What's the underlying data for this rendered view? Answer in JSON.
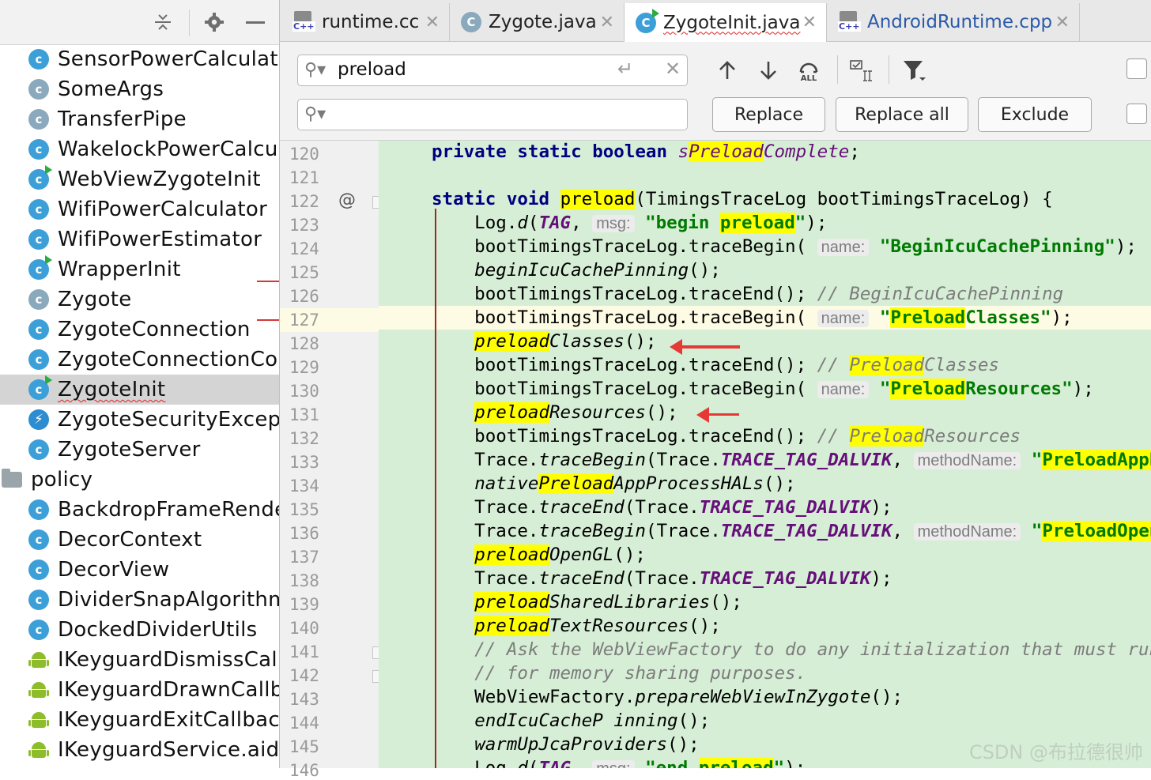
{
  "left_toolbar": {
    "icons": [
      "collapse-all-icon",
      "gear-icon",
      "minimize-icon"
    ]
  },
  "tree": [
    {
      "label": "SensorPowerCalculator",
      "icon": "class-icon"
    },
    {
      "label": "SomeArgs",
      "icon": "class-icon-greyed"
    },
    {
      "label": "TransferPipe",
      "icon": "class-icon-greyed"
    },
    {
      "label": "WakelockPowerCalculator",
      "icon": "class-icon"
    },
    {
      "label": "WebViewZygoteInit",
      "icon": "runnable-class-icon"
    },
    {
      "label": "WifiPowerCalculator",
      "icon": "class-icon"
    },
    {
      "label": "WifiPowerEstimator",
      "icon": "class-icon"
    },
    {
      "label": "WrapperInit",
      "icon": "runnable-class-icon"
    },
    {
      "label": "Zygote",
      "icon": "class-icon-greyed"
    },
    {
      "label": "ZygoteConnection",
      "icon": "class-icon"
    },
    {
      "label": "ZygoteConnectionConstants",
      "icon": "class-icon"
    },
    {
      "label": "ZygoteInit",
      "icon": "runnable-class-icon",
      "selected": true
    },
    {
      "label": "ZygoteSecurityException",
      "icon": "exception-class-icon"
    },
    {
      "label": "ZygoteServer",
      "icon": "class-icon"
    },
    {
      "label": "policy",
      "icon": "folder-icon"
    },
    {
      "label": "BackdropFrameRenderer",
      "icon": "class-icon"
    },
    {
      "label": "DecorContext",
      "icon": "class-icon"
    },
    {
      "label": "DecorView",
      "icon": "class-icon"
    },
    {
      "label": "DividerSnapAlgorithm",
      "icon": "class-icon"
    },
    {
      "label": "DockedDividerUtils",
      "icon": "class-icon"
    },
    {
      "label": "IKeyguardDismissCallback",
      "icon": "android-icon"
    },
    {
      "label": "IKeyguardDrawnCallback",
      "icon": "android-icon"
    },
    {
      "label": "IKeyguardExitCallback",
      "icon": "android-icon"
    },
    {
      "label": "IKeyguardService.aidl",
      "icon": "android-icon"
    }
  ],
  "tabs": [
    {
      "label": "runtime.cc",
      "icon": "cpp-file-icon"
    },
    {
      "label": "Zygote.java",
      "icon": "class-icon-greyed"
    },
    {
      "label": "ZygoteInit.java",
      "icon": "runnable-class-icon",
      "active": true
    },
    {
      "label": "AndroidRuntime.cpp",
      "icon": "cpp-file-icon"
    }
  ],
  "find": {
    "search_value": "preload",
    "replace_value": "",
    "replace_label": "Replace",
    "replace_all_label": "Replace all",
    "exclude_label": "Exclude",
    "all_label": "ALL"
  },
  "editor": {
    "current_line": 127,
    "line_numbers": [
      "120",
      "121",
      "122",
      "123",
      "124",
      "125",
      "126",
      "127",
      "128",
      "129",
      "130",
      "131",
      "132",
      "133",
      "134",
      "135",
      "136",
      "137",
      "138",
      "139",
      "140",
      "141",
      "142",
      "143",
      "144",
      "145",
      "146"
    ],
    "gutter_marker_line": 122,
    "gutter_marker": "@",
    "hints": {
      "msg": "msg:",
      "name": "name:",
      "methodName": "methodName:"
    },
    "lines": [
      [
        [
          "kw",
          "private static boolean "
        ],
        [
          "fld",
          "s"
        ],
        [
          "fld hl",
          "Preload"
        ],
        [
          "fld",
          "Complete"
        ],
        [
          "t",
          ";"
        ]
      ],
      [],
      [
        [
          "kw",
          "static void "
        ],
        [
          "hl",
          "preload"
        ],
        [
          "t",
          "(TimingsTraceLog bootTimingsTraceLog) {"
        ]
      ],
      [
        [
          "t",
          "    Log."
        ],
        [
          "it",
          "d"
        ],
        [
          "t",
          "("
        ],
        [
          "cst",
          "TAG"
        ],
        [
          "t",
          ", "
        ],
        [
          "hint",
          "msg:"
        ],
        [
          "t",
          " "
        ],
        [
          "str",
          "\"begin "
        ],
        [
          "str hl",
          "preload"
        ],
        [
          "str",
          "\""
        ],
        [
          "t",
          ");"
        ]
      ],
      [
        [
          "t",
          "    bootTimingsTraceLog.traceBegin( "
        ],
        [
          "hint",
          "name:"
        ],
        [
          "t",
          " "
        ],
        [
          "str",
          "\"BeginIcuCachePinning\""
        ],
        [
          "t",
          ");"
        ]
      ],
      [
        [
          "t",
          "    "
        ],
        [
          "it",
          "beginIcuCachePinning"
        ],
        [
          "t",
          "();"
        ]
      ],
      [
        [
          "t",
          "    bootTimingsTraceLog.traceEnd(); "
        ],
        [
          "cmt",
          "// BeginIcuCachePinning"
        ]
      ],
      [
        [
          "t",
          "    bootTimingsTraceLog.traceBegin( "
        ],
        [
          "hint",
          "name:"
        ],
        [
          "t",
          " "
        ],
        [
          "str",
          "\""
        ],
        [
          "str hl",
          "Preload"
        ],
        [
          "str",
          "Classes\""
        ],
        [
          "t",
          ");"
        ]
      ],
      [
        [
          "t",
          "    "
        ],
        [
          "it hl",
          "preload"
        ],
        [
          "it",
          "Classes"
        ],
        [
          "t",
          "();"
        ]
      ],
      [
        [
          "t",
          "    bootTimingsTraceLog.traceEnd(); "
        ],
        [
          "cmt",
          "// "
        ],
        [
          "cmt hl",
          "Preload"
        ],
        [
          "cmt",
          "Classes"
        ]
      ],
      [
        [
          "t",
          "    bootTimingsTraceLog.traceBegin( "
        ],
        [
          "hint",
          "name:"
        ],
        [
          "t",
          " "
        ],
        [
          "str",
          "\""
        ],
        [
          "str hl",
          "Preload"
        ],
        [
          "str",
          "Resources\""
        ],
        [
          "t",
          ");"
        ]
      ],
      [
        [
          "t",
          "    "
        ],
        [
          "it hl",
          "preload"
        ],
        [
          "it",
          "Resources"
        ],
        [
          "t",
          "();"
        ]
      ],
      [
        [
          "t",
          "    bootTimingsTraceLog.traceEnd(); "
        ],
        [
          "cmt",
          "// "
        ],
        [
          "cmt hl",
          "Preload"
        ],
        [
          "cmt",
          "Resources"
        ]
      ],
      [
        [
          "t",
          "    Trace."
        ],
        [
          "it",
          "traceBegin"
        ],
        [
          "t",
          "(Trace."
        ],
        [
          "cst",
          "TRACE_TAG_DALVIK"
        ],
        [
          "t",
          ", "
        ],
        [
          "hint",
          "methodName:"
        ],
        [
          "t",
          " "
        ],
        [
          "str",
          "\""
        ],
        [
          "str hl",
          "PreloadAppProcessHALs"
        ],
        [
          "str",
          "\""
        ]
      ],
      [
        [
          "t",
          "    "
        ],
        [
          "it",
          "native"
        ],
        [
          "it hl",
          "Preload"
        ],
        [
          "it",
          "AppProcessHALs"
        ],
        [
          "t",
          "();"
        ]
      ],
      [
        [
          "t",
          "    Trace."
        ],
        [
          "it",
          "traceEnd"
        ],
        [
          "t",
          "(Trace."
        ],
        [
          "cst",
          "TRACE_TAG_DALVIK"
        ],
        [
          "t",
          ");"
        ]
      ],
      [
        [
          "t",
          "    Trace."
        ],
        [
          "it",
          "traceBegin"
        ],
        [
          "t",
          "(Trace."
        ],
        [
          "cst",
          "TRACE_TAG_DALVIK"
        ],
        [
          "t",
          ", "
        ],
        [
          "hint",
          "methodName:"
        ],
        [
          "t",
          " "
        ],
        [
          "str",
          "\""
        ],
        [
          "str hl",
          "PreloadOpenGL"
        ],
        [
          "str",
          "\""
        ]
      ],
      [
        [
          "t",
          "    "
        ],
        [
          "it hl",
          "preload"
        ],
        [
          "it",
          "OpenGL"
        ],
        [
          "t",
          "();"
        ]
      ],
      [
        [
          "t",
          "    Trace."
        ],
        [
          "it",
          "traceEnd"
        ],
        [
          "t",
          "(Trace."
        ],
        [
          "cst",
          "TRACE_TAG_DALVIK"
        ],
        [
          "t",
          ");"
        ]
      ],
      [
        [
          "t",
          "    "
        ],
        [
          "it hl",
          "preload"
        ],
        [
          "it",
          "SharedLibraries"
        ],
        [
          "t",
          "();"
        ]
      ],
      [
        [
          "t",
          "    "
        ],
        [
          "it hl",
          "preload"
        ],
        [
          "it",
          "TextResources"
        ],
        [
          "t",
          "();"
        ]
      ],
      [
        [
          "t",
          "    "
        ],
        [
          "cmt",
          "// Ask the WebViewFactory to do any initialization that must run in the zygote"
        ]
      ],
      [
        [
          "t",
          "    "
        ],
        [
          "cmt",
          "// for memory sharing purposes."
        ]
      ],
      [
        [
          "t",
          "    WebViewFactory."
        ],
        [
          "it",
          "prepareWebViewInZygote"
        ],
        [
          "t",
          "();"
        ]
      ],
      [
        [
          "t",
          "    "
        ],
        [
          "it",
          "endIcuCacheP inning"
        ],
        [
          "t",
          "();"
        ]
      ],
      [
        [
          "t",
          "    "
        ],
        [
          "it",
          "warmUpJcaProviders"
        ],
        [
          "t",
          "();"
        ]
      ],
      [
        [
          "t",
          "    Log."
        ],
        [
          "it",
          "d"
        ],
        [
          "t",
          "("
        ],
        [
          "cst",
          "TAG"
        ],
        [
          "t",
          ", "
        ],
        [
          "hint",
          "msg:"
        ],
        [
          "t",
          " "
        ],
        [
          "str",
          "\"end "
        ],
        [
          "str hl",
          "preload"
        ],
        [
          "str",
          "\""
        ],
        [
          "t",
          ");"
        ]
      ]
    ]
  },
  "watermark": "CSDN @布拉德很帅",
  "colors": {
    "code_background": "#d6eed6",
    "search_highlight": "#ffff00",
    "annotation_arrow": "#e53935",
    "class_icon": "#3d9fd8"
  }
}
